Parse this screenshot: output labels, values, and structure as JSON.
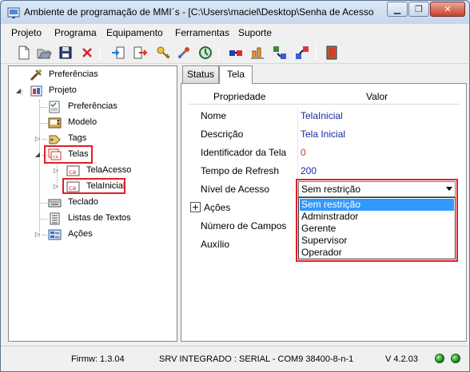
{
  "window": {
    "title": "Ambiente de programação de MMI´s - [C:\\Users\\maciel\\Desktop\\Senha de Acesso",
    "minimize_glyph": "▁",
    "restore_glyph": "❐",
    "close_glyph": "✕"
  },
  "menu": [
    "Projeto",
    "Programa",
    "Equipamento",
    "Ferramentas",
    "Suporte"
  ],
  "toolbar": {
    "icons": [
      "new-file-icon",
      "open-folder-icon",
      "save-icon",
      "delete-icon",
      "import-icon",
      "export-icon",
      "key-icon",
      "tools-icon",
      "refresh-icon",
      "connect-icon",
      "transfer-icon",
      "download-icon",
      "upload-icon",
      "exit-icon"
    ]
  },
  "tree": {
    "items": [
      {
        "label": "Preferências",
        "icon": "tools-icon"
      },
      {
        "label": "Projeto",
        "icon": "project-icon"
      },
      {
        "label": "Preferências",
        "icon": "document-icon"
      },
      {
        "label": "Modelo",
        "icon": "device-icon"
      },
      {
        "label": "Tags",
        "icon": "tags-icon"
      },
      {
        "label": "Telas",
        "icon": "screens-icon"
      },
      {
        "label": "TelaAcesso",
        "icon": "screen-icon"
      },
      {
        "label": "TelaInicial",
        "icon": "screen-icon"
      },
      {
        "label": "Teclado",
        "icon": "keyboard-icon"
      },
      {
        "label": "Listas de Textos",
        "icon": "list-icon"
      },
      {
        "label": "Ações",
        "icon": "actions-icon"
      }
    ]
  },
  "tabs": [
    "Status",
    "Tela"
  ],
  "properties": {
    "header": {
      "name": "Propriedade",
      "value": "Valor"
    },
    "rows": [
      {
        "name": "Nome",
        "value": "TelaInicial"
      },
      {
        "name": "Descrição",
        "value": "Tela Inicial"
      },
      {
        "name": "Identificador da Tela",
        "value": "0"
      },
      {
        "name": "Tempo de Refresh",
        "value": "200"
      },
      {
        "name": "Nível de Acesso",
        "value": "Sem restrição"
      },
      {
        "name": "Ações",
        "value": ""
      },
      {
        "name": "Número de Campos",
        "value": ""
      },
      {
        "name": "Auxílio",
        "value": ""
      }
    ],
    "group_toggle": "+"
  },
  "access_dropdown": {
    "selected": "Sem restrição",
    "options": [
      "Sem restrição",
      "Adminstrador",
      "Gerente",
      "Supervisor",
      "Operador"
    ]
  },
  "status": {
    "firmware": "Firmw: 1.3.04",
    "connection": "SRV INTEGRADO : SERIAL - COM9 38400-8-n-1",
    "version": "V 4.2.03",
    "leds": [
      "green",
      "green"
    ]
  },
  "colors": {
    "highlight_border": "#e21f26",
    "value_text": "#1a2aa8",
    "selection": "#3399ff"
  }
}
